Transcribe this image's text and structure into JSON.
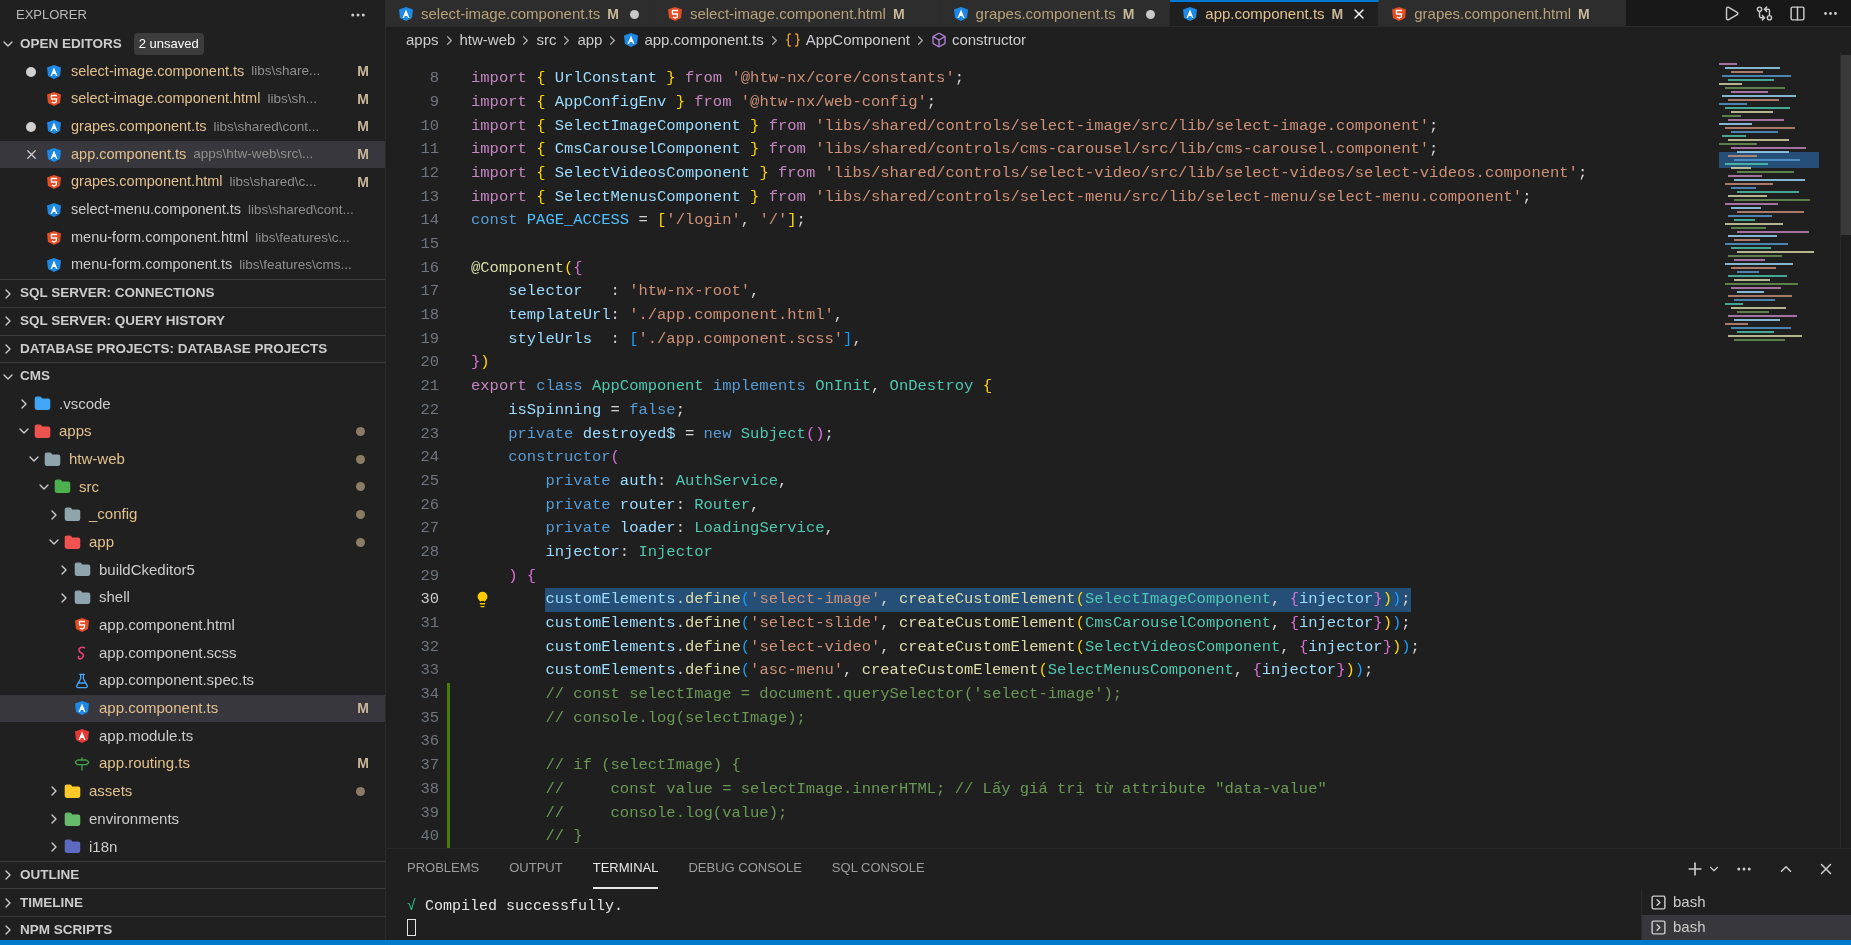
{
  "sidebar": {
    "title": "EXPLORER",
    "open_editors": {
      "title": "OPEN EDITORS",
      "badge": "2 unsaved",
      "expanded": true,
      "items": [
        {
          "name": "select-image.component.ts",
          "path": "libs\\share...",
          "status": "M",
          "kind": "angular",
          "dirty": true,
          "selected": false
        },
        {
          "name": "select-image.component.html",
          "path": "libs\\sh...",
          "status": "M",
          "kind": "html",
          "dirty": false,
          "selected": false
        },
        {
          "name": "grapes.component.ts",
          "path": "libs\\shared\\cont...",
          "status": "M",
          "kind": "angular",
          "dirty": true,
          "selected": false
        },
        {
          "name": "app.component.ts",
          "path": "apps\\htw-web\\src\\...",
          "status": "M",
          "kind": "angular",
          "dirty": false,
          "selected": true
        },
        {
          "name": "grapes.component.html",
          "path": "libs\\shared\\c...",
          "status": "M",
          "kind": "html",
          "dirty": false,
          "selected": false
        },
        {
          "name": "select-menu.component.ts",
          "path": "libs\\shared\\cont...",
          "kind": "angular",
          "dirty": false,
          "selected": false
        },
        {
          "name": "menu-form.component.html",
          "path": "libs\\features\\c...",
          "kind": "html",
          "dirty": false,
          "selected": false
        },
        {
          "name": "menu-form.component.ts",
          "path": "libs\\features\\cms...",
          "kind": "angular",
          "dirty": false,
          "selected": false
        }
      ]
    },
    "sections_top": [
      {
        "title": "SQL SERVER: CONNECTIONS",
        "expanded": false
      },
      {
        "title": "SQL SERVER: QUERY HISTORY",
        "expanded": false
      },
      {
        "title": "DATABASE PROJECTS: DATABASE PROJECTS",
        "expanded": false
      }
    ],
    "workspace": {
      "title": "CMS",
      "expanded": true,
      "tree": [
        {
          "name": ".vscode",
          "kind": "folder-vscode",
          "expanded": false,
          "modified": false,
          "dot": false,
          "selected": false
        },
        {
          "name": "apps",
          "kind": "folder-app",
          "expanded": true,
          "modified": true,
          "dot": true,
          "selected": false,
          "children": [
            {
              "name": "htw-web",
              "kind": "folder",
              "expanded": true,
              "modified": true,
              "dot": true,
              "selected": false,
              "children": [
                {
                  "name": "src",
                  "kind": "folder-src",
                  "expanded": true,
                  "modified": true,
                  "dot": true,
                  "selected": false,
                  "children": [
                    {
                      "name": "_config",
                      "kind": "folder",
                      "expanded": false,
                      "modified": true,
                      "dot": true,
                      "selected": false
                    },
                    {
                      "name": "app",
                      "kind": "folder-app",
                      "expanded": true,
                      "modified": true,
                      "dot": true,
                      "selected": false,
                      "children": [
                        {
                          "name": "buildCkeditor5",
                          "kind": "folder",
                          "expanded": false,
                          "modified": false,
                          "dot": false,
                          "selected": false
                        },
                        {
                          "name": "shell",
                          "kind": "folder",
                          "expanded": false,
                          "modified": false,
                          "dot": false,
                          "selected": false
                        },
                        {
                          "name": "app.component.html",
                          "kind": "html",
                          "modified": false,
                          "dot": false,
                          "selected": false
                        },
                        {
                          "name": "app.component.scss",
                          "kind": "scss",
                          "modified": false,
                          "dot": false,
                          "selected": false
                        },
                        {
                          "name": "app.component.spec.ts",
                          "kind": "spec",
                          "modified": false,
                          "dot": false,
                          "selected": false
                        },
                        {
                          "name": "app.component.ts",
                          "kind": "angular",
                          "status": "M",
                          "modified": true,
                          "dot": false,
                          "selected": true
                        },
                        {
                          "name": "app.module.ts",
                          "kind": "angular-module",
                          "modified": false,
                          "dot": false,
                          "selected": false
                        },
                        {
                          "name": "app.routing.ts",
                          "kind": "routing",
                          "status": "M",
                          "modified": true,
                          "dot": false,
                          "selected": false
                        }
                      ]
                    },
                    {
                      "name": "assets",
                      "kind": "folder-assets",
                      "expanded": false,
                      "modified": true,
                      "dot": true,
                      "selected": false
                    },
                    {
                      "name": "environments",
                      "kind": "folder-env",
                      "expanded": false,
                      "modified": false,
                      "dot": false,
                      "selected": false
                    },
                    {
                      "name": "i18n",
                      "kind": "folder-i18n",
                      "expanded": false,
                      "modified": false,
                      "dot": false,
                      "selected": false
                    }
                  ]
                }
              ]
            }
          ]
        }
      ]
    },
    "sections_bottom": [
      {
        "title": "OUTLINE",
        "expanded": false
      },
      {
        "title": "TIMELINE",
        "expanded": false
      },
      {
        "title": "NPM SCRIPTS",
        "expanded": false
      }
    ]
  },
  "tabs": [
    {
      "label": "select-image.component.ts",
      "status": "M",
      "kind": "angular",
      "dirty": true,
      "selected": false
    },
    {
      "label": "select-image.component.html",
      "status": "M",
      "kind": "html",
      "dirty": false,
      "selected": false
    },
    {
      "label": "grapes.component.ts",
      "status": "M",
      "kind": "angular",
      "dirty": true,
      "selected": false
    },
    {
      "label": "app.component.ts",
      "status": "M",
      "kind": "angular",
      "dirty": false,
      "selected": true
    },
    {
      "label": "grapes.component.html",
      "status": "M",
      "kind": "html",
      "dirty": false,
      "selected": false
    }
  ],
  "breadcrumb": [
    {
      "label": "apps",
      "kind": "folder"
    },
    {
      "label": "htw-web",
      "kind": "folder"
    },
    {
      "label": "src",
      "kind": "folder"
    },
    {
      "label": "app",
      "kind": "folder"
    },
    {
      "label": "app.component.ts",
      "kind": "file"
    },
    {
      "label": "AppComponent",
      "kind": "class"
    },
    {
      "label": "constructor",
      "kind": "method"
    }
  ],
  "code": [
    {
      "n": "8",
      "selected": false,
      "modified": false,
      "lightbulb": false,
      "tokens": [
        {
          "text": "import ",
          "kind": "ctrl"
        },
        {
          "text": "{ ",
          "kind": "p1"
        },
        {
          "text": "UrlConstant ",
          "kind": "var"
        },
        {
          "text": "} ",
          "kind": "p1"
        },
        {
          "text": "from ",
          "kind": "ctrl"
        },
        {
          "text": "'@htw-nx/core/constants'",
          "kind": "str"
        },
        {
          "text": ";",
          "kind": "plain"
        }
      ]
    },
    {
      "n": "9",
      "selected": false,
      "modified": false,
      "lightbulb": false,
      "tokens": [
        {
          "text": "import ",
          "kind": "ctrl"
        },
        {
          "text": "{ ",
          "kind": "p1"
        },
        {
          "text": "AppConfigEnv ",
          "kind": "var"
        },
        {
          "text": "} ",
          "kind": "p1"
        },
        {
          "text": "from ",
          "kind": "ctrl"
        },
        {
          "text": "'@htw-nx/web-config'",
          "kind": "str"
        },
        {
          "text": ";",
          "kind": "plain"
        }
      ]
    },
    {
      "n": "10",
      "selected": false,
      "modified": false,
      "lightbulb": false,
      "tokens": [
        {
          "text": "import ",
          "kind": "ctrl"
        },
        {
          "text": "{ ",
          "kind": "p1"
        },
        {
          "text": "SelectImageComponent ",
          "kind": "var"
        },
        {
          "text": "} ",
          "kind": "p1"
        },
        {
          "text": "from ",
          "kind": "ctrl"
        },
        {
          "text": "'libs/shared/controls/select-image/src/lib/select-image.component'",
          "kind": "str"
        },
        {
          "text": ";",
          "kind": "plain"
        }
      ]
    },
    {
      "n": "11",
      "selected": false,
      "modified": false,
      "lightbulb": false,
      "tokens": [
        {
          "text": "import ",
          "kind": "ctrl"
        },
        {
          "text": "{ ",
          "kind": "p1"
        },
        {
          "text": "CmsCarouselComponent ",
          "kind": "var"
        },
        {
          "text": "} ",
          "kind": "p1"
        },
        {
          "text": "from ",
          "kind": "ctrl"
        },
        {
          "text": "'libs/shared/controls/cms-carousel/src/lib/cms-carousel.component'",
          "kind": "str"
        },
        {
          "text": ";",
          "kind": "plain"
        }
      ]
    },
    {
      "n": "12",
      "selected": false,
      "modified": false,
      "lightbulb": false,
      "tokens": [
        {
          "text": "import ",
          "kind": "ctrl"
        },
        {
          "text": "{ ",
          "kind": "p1"
        },
        {
          "text": "SelectVideosComponent ",
          "kind": "var"
        },
        {
          "text": "} ",
          "kind": "p1"
        },
        {
          "text": "from ",
          "kind": "ctrl"
        },
        {
          "text": "'libs/shared/controls/select-video/src/lib/select-videos/select-videos.component'",
          "kind": "str"
        },
        {
          "text": ";",
          "kind": "plain"
        }
      ]
    },
    {
      "n": "13",
      "selected": false,
      "modified": false,
      "lightbulb": false,
      "tokens": [
        {
          "text": "import ",
          "kind": "ctrl"
        },
        {
          "text": "{ ",
          "kind": "p1"
        },
        {
          "text": "SelectMenusComponent ",
          "kind": "var"
        },
        {
          "text": "} ",
          "kind": "p1"
        },
        {
          "text": "from ",
          "kind": "ctrl"
        },
        {
          "text": "'libs/shared/controls/select-menu/src/lib/select-menu/select-menu.component'",
          "kind": "str"
        },
        {
          "text": ";",
          "kind": "plain"
        }
      ]
    },
    {
      "n": "14",
      "selected": false,
      "modified": false,
      "lightbulb": false,
      "tokens": [
        {
          "text": "const ",
          "kind": "kw"
        },
        {
          "text": "PAGE_ACCESS",
          "kind": "const"
        },
        {
          "text": " = ",
          "kind": "plain"
        },
        {
          "text": "[",
          "kind": "p1"
        },
        {
          "text": "'/login'",
          "kind": "str"
        },
        {
          "text": ", ",
          "kind": "plain"
        },
        {
          "text": "'/'",
          "kind": "str"
        },
        {
          "text": "]",
          "kind": "p1"
        },
        {
          "text": ";",
          "kind": "plain"
        }
      ]
    },
    {
      "n": "15",
      "selected": false,
      "modified": false,
      "lightbulb": false
    },
    {
      "n": "16",
      "selected": false,
      "modified": false,
      "lightbulb": false,
      "tokens": [
        {
          "text": "@Component",
          "kind": "fn"
        },
        {
          "text": "(",
          "kind": "p1"
        },
        {
          "text": "{",
          "kind": "p2"
        }
      ]
    },
    {
      "n": "17",
      "selected": false,
      "modified": false,
      "lightbulb": false,
      "tokens": [
        {
          "text": "    selector",
          "kind": "var"
        },
        {
          "text": "   : ",
          "kind": "plain"
        },
        {
          "text": "'htw-nx-root'",
          "kind": "str"
        },
        {
          "text": ",",
          "kind": "plain"
        }
      ]
    },
    {
      "n": "18",
      "selected": false,
      "modified": false,
      "lightbulb": false,
      "tokens": [
        {
          "text": "    templateUrl",
          "kind": "var"
        },
        {
          "text": ": ",
          "kind": "plain"
        },
        {
          "text": "'./app.component.html'",
          "kind": "str"
        },
        {
          "text": ",",
          "kind": "plain"
        }
      ]
    },
    {
      "n": "19",
      "selected": false,
      "modified": false,
      "lightbulb": false,
      "tokens": [
        {
          "text": "    styleUrls",
          "kind": "var"
        },
        {
          "text": "  : ",
          "kind": "plain"
        },
        {
          "text": "[",
          "kind": "p3"
        },
        {
          "text": "'./app.component.scss'",
          "kind": "str"
        },
        {
          "text": "]",
          "kind": "p3"
        },
        {
          "text": ",",
          "kind": "plain"
        }
      ]
    },
    {
      "n": "20",
      "selected": false,
      "modified": false,
      "lightbulb": false,
      "tokens": [
        {
          "text": "}",
          "kind": "p2"
        },
        {
          "text": ")",
          "kind": "p1"
        }
      ]
    },
    {
      "n": "21",
      "selected": false,
      "modified": false,
      "lightbulb": false,
      "tokens": [
        {
          "text": "export ",
          "kind": "ctrl"
        },
        {
          "text": "class ",
          "kind": "kw"
        },
        {
          "text": "AppComponent ",
          "kind": "type"
        },
        {
          "text": "implements ",
          "kind": "kw"
        },
        {
          "text": "OnInit",
          "kind": "type"
        },
        {
          "text": ", ",
          "kind": "plain"
        },
        {
          "text": "OnDestroy ",
          "kind": "type"
        },
        {
          "text": "{",
          "kind": "p1"
        }
      ]
    },
    {
      "n": "22",
      "selected": false,
      "modified": false,
      "lightbulb": false,
      "tokens": [
        {
          "text": "    isSpinning",
          "kind": "var"
        },
        {
          "text": " = ",
          "kind": "plain"
        },
        {
          "text": "false",
          "kind": "kw"
        },
        {
          "text": ";",
          "kind": "plain"
        }
      ]
    },
    {
      "n": "23",
      "selected": false,
      "modified": false,
      "lightbulb": false,
      "tokens": [
        {
          "text": "    private ",
          "kind": "kw"
        },
        {
          "text": "destroyed$",
          "kind": "var"
        },
        {
          "text": " = ",
          "kind": "plain"
        },
        {
          "text": "new ",
          "kind": "kw"
        },
        {
          "text": "Subject",
          "kind": "type"
        },
        {
          "text": "()",
          "kind": "p2"
        },
        {
          "text": ";",
          "kind": "plain"
        }
      ]
    },
    {
      "n": "24",
      "selected": false,
      "modified": false,
      "lightbulb": false,
      "tokens": [
        {
          "text": "    constructor",
          "kind": "kw"
        },
        {
          "text": "(",
          "kind": "p2"
        }
      ]
    },
    {
      "n": "25",
      "selected": false,
      "modified": false,
      "lightbulb": false,
      "tokens": [
        {
          "text": "        private ",
          "kind": "kw"
        },
        {
          "text": "auth",
          "kind": "var"
        },
        {
          "text": ": ",
          "kind": "plain"
        },
        {
          "text": "AuthService",
          "kind": "type"
        },
        {
          "text": ",",
          "kind": "plain"
        }
      ]
    },
    {
      "n": "26",
      "selected": false,
      "modified": false,
      "lightbulb": false,
      "tokens": [
        {
          "text": "        private ",
          "kind": "kw"
        },
        {
          "text": "router",
          "kind": "var"
        },
        {
          "text": ": ",
          "kind": "plain"
        },
        {
          "text": "Router",
          "kind": "type"
        },
        {
          "text": ",",
          "kind": "plain"
        }
      ]
    },
    {
      "n": "27",
      "selected": false,
      "modified": false,
      "lightbulb": false,
      "tokens": [
        {
          "text": "        private ",
          "kind": "kw"
        },
        {
          "text": "loader",
          "kind": "var"
        },
        {
          "text": ": ",
          "kind": "plain"
        },
        {
          "text": "LoadingService",
          "kind": "type"
        },
        {
          "text": ",",
          "kind": "plain"
        }
      ]
    },
    {
      "n": "28",
      "selected": false,
      "modified": false,
      "lightbulb": false,
      "tokens": [
        {
          "text": "        injector",
          "kind": "var"
        },
        {
          "text": ": ",
          "kind": "plain"
        },
        {
          "text": "Injector",
          "kind": "type"
        }
      ]
    },
    {
      "n": "29",
      "selected": false,
      "modified": false,
      "lightbulb": false,
      "tokens": [
        {
          "text": "    )",
          "kind": "p2"
        },
        {
          "text": " {",
          "kind": "p2"
        }
      ]
    },
    {
      "n": "30",
      "selected": true,
      "modified": false,
      "lightbulb": true,
      "tokens": [
        {
          "text": "        customElements",
          "kind": "var"
        },
        {
          "text": ".",
          "kind": "plain"
        },
        {
          "text": "define",
          "kind": "fn"
        },
        {
          "text": "(",
          "kind": "p3"
        },
        {
          "text": "'select-image'",
          "kind": "str"
        },
        {
          "text": ", ",
          "kind": "plain"
        },
        {
          "text": "createCustomElement",
          "kind": "fn"
        },
        {
          "text": "(",
          "kind": "p1"
        },
        {
          "text": "SelectImageComponent",
          "kind": "type"
        },
        {
          "text": ", ",
          "kind": "plain"
        },
        {
          "text": "{",
          "kind": "p2"
        },
        {
          "text": "injector",
          "kind": "var"
        },
        {
          "text": "}",
          "kind": "p2"
        },
        {
          "text": ")",
          "kind": "p1"
        },
        {
          "text": ")",
          "kind": "p3"
        },
        {
          "text": ";",
          "kind": "plain"
        }
      ]
    },
    {
      "n": "31",
      "selected": false,
      "modified": false,
      "lightbulb": false,
      "tokens": [
        {
          "text": "        customElements",
          "kind": "var"
        },
        {
          "text": ".",
          "kind": "plain"
        },
        {
          "text": "define",
          "kind": "fn"
        },
        {
          "text": "(",
          "kind": "p3"
        },
        {
          "text": "'select-slide'",
          "kind": "str"
        },
        {
          "text": ", ",
          "kind": "plain"
        },
        {
          "text": "createCustomElement",
          "kind": "fn"
        },
        {
          "text": "(",
          "kind": "p1"
        },
        {
          "text": "CmsCarouselComponent",
          "kind": "type"
        },
        {
          "text": ", ",
          "kind": "plain"
        },
        {
          "text": "{",
          "kind": "p2"
        },
        {
          "text": "injector",
          "kind": "var"
        },
        {
          "text": "}",
          "kind": "p2"
        },
        {
          "text": ")",
          "kind": "p1"
        },
        {
          "text": ")",
          "kind": "p3"
        },
        {
          "text": ";",
          "kind": "plain"
        }
      ]
    },
    {
      "n": "32",
      "selected": false,
      "modified": false,
      "lightbulb": false,
      "tokens": [
        {
          "text": "        customElements",
          "kind": "var"
        },
        {
          "text": ".",
          "kind": "plain"
        },
        {
          "text": "define",
          "kind": "fn"
        },
        {
          "text": "(",
          "kind": "p3"
        },
        {
          "text": "'select-video'",
          "kind": "str"
        },
        {
          "text": ", ",
          "kind": "plain"
        },
        {
          "text": "createCustomElement",
          "kind": "fn"
        },
        {
          "text": "(",
          "kind": "p1"
        },
        {
          "text": "SelectVideosComponent",
          "kind": "type"
        },
        {
          "text": ", ",
          "kind": "plain"
        },
        {
          "text": "{",
          "kind": "p2"
        },
        {
          "text": "injector",
          "kind": "var"
        },
        {
          "text": "}",
          "kind": "p2"
        },
        {
          "text": ")",
          "kind": "p1"
        },
        {
          "text": ")",
          "kind": "p3"
        },
        {
          "text": ";",
          "kind": "plain"
        }
      ]
    },
    {
      "n": "33",
      "selected": false,
      "modified": false,
      "lightbulb": false,
      "tokens": [
        {
          "text": "        customElements",
          "kind": "var"
        },
        {
          "text": ".",
          "kind": "plain"
        },
        {
          "text": "define",
          "kind": "fn"
        },
        {
          "text": "(",
          "kind": "p3"
        },
        {
          "text": "'asc-menu'",
          "kind": "str"
        },
        {
          "text": ", ",
          "kind": "plain"
        },
        {
          "text": "createCustomElement",
          "kind": "fn"
        },
        {
          "text": "(",
          "kind": "p1"
        },
        {
          "text": "SelectMenusComponent",
          "kind": "type"
        },
        {
          "text": ", ",
          "kind": "plain"
        },
        {
          "text": "{",
          "kind": "p2"
        },
        {
          "text": "injector",
          "kind": "var"
        },
        {
          "text": "}",
          "kind": "p2"
        },
        {
          "text": ")",
          "kind": "p1"
        },
        {
          "text": ")",
          "kind": "p3"
        },
        {
          "text": ";",
          "kind": "plain"
        }
      ]
    },
    {
      "n": "34",
      "selected": false,
      "modified": true,
      "lightbulb": false,
      "tokens": [
        {
          "text": "        // const selectImage = document.querySelector('select-image');",
          "kind": "cm"
        }
      ]
    },
    {
      "n": "35",
      "selected": false,
      "modified": true,
      "lightbulb": false,
      "tokens": [
        {
          "text": "        // console.log(selectImage);",
          "kind": "cm"
        }
      ]
    },
    {
      "n": "36",
      "selected": false,
      "modified": true,
      "lightbulb": false
    },
    {
      "n": "37",
      "selected": false,
      "modified": true,
      "lightbulb": false,
      "tokens": [
        {
          "text": "        // if (selectImage) {",
          "kind": "cm"
        }
      ]
    },
    {
      "n": "38",
      "selected": false,
      "modified": true,
      "lightbulb": false,
      "tokens": [
        {
          "text": "        //     const value = selectImage.innerHTML; // Lấy giá trị từ attribute \"data-value\"",
          "kind": "cm"
        }
      ]
    },
    {
      "n": "39",
      "selected": false,
      "modified": true,
      "lightbulb": false,
      "tokens": [
        {
          "text": "        //     console.log(value);",
          "kind": "cm"
        }
      ]
    },
    {
      "n": "40",
      "selected": false,
      "modified": true,
      "lightbulb": false,
      "tokens": [
        {
          "text": "        // }",
          "kind": "cm"
        }
      ]
    }
  ],
  "panel": {
    "tabs": [
      {
        "label": "PROBLEMS",
        "selected": false
      },
      {
        "label": "OUTPUT",
        "selected": false
      },
      {
        "label": "TERMINAL",
        "selected": true
      },
      {
        "label": "DEBUG CONSOLE",
        "selected": false
      },
      {
        "label": "SQL CONSOLE",
        "selected": false
      }
    ],
    "terminal": {
      "lines": [
        {
          "prefix": "√",
          "text": "Compiled successfully."
        }
      ],
      "cursor": true
    },
    "terminals": [
      {
        "label": "bash",
        "selected": false
      },
      {
        "label": "bash",
        "selected": true
      }
    ]
  }
}
